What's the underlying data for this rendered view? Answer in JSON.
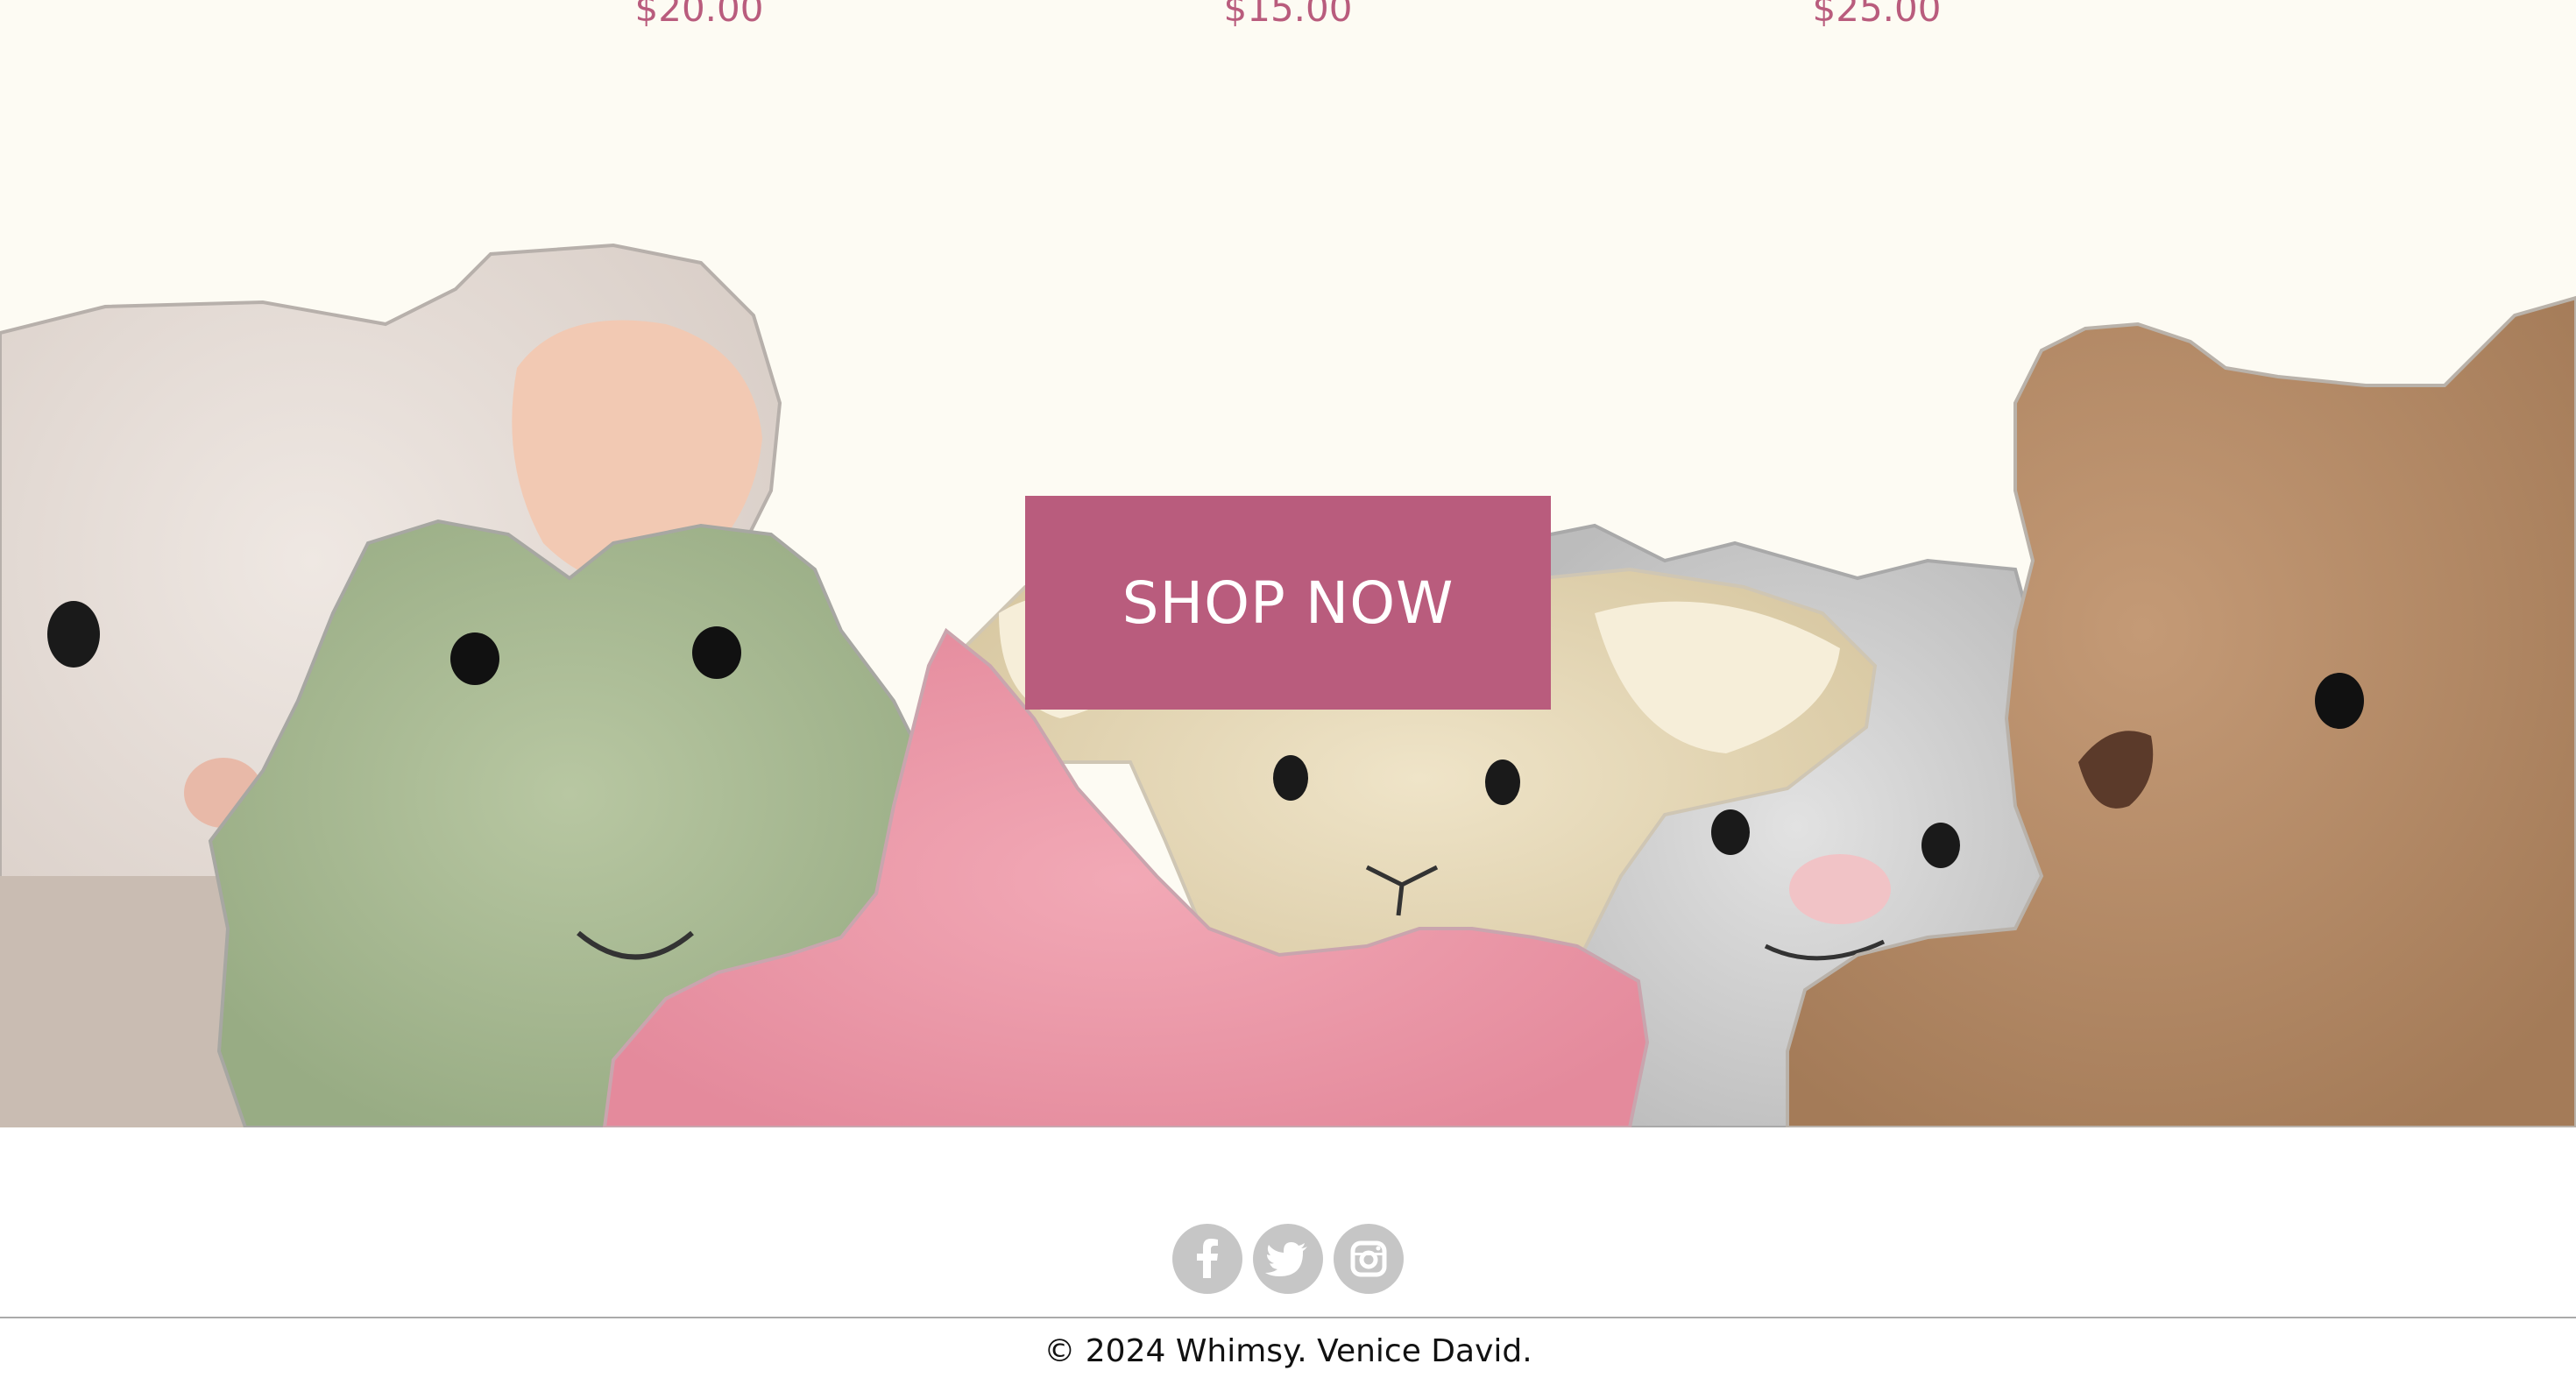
{
  "products": {
    "prices": [
      "$20.00",
      "$15.00",
      "$25.00"
    ]
  },
  "hero": {
    "cta_label": "SHOP NOW",
    "illustration": [
      "mouse plush",
      "frog plush",
      "pink starfish plush",
      "lamb plush",
      "grey bunny plush",
      "brown teddy bear plush"
    ]
  },
  "footer": {
    "social": [
      {
        "name": "facebook",
        "icon": "facebook-icon"
      },
      {
        "name": "twitter",
        "icon": "twitter-icon"
      },
      {
        "name": "instagram",
        "icon": "instagram-icon"
      }
    ],
    "copyright": "© 2024 Whimsy. Venice David."
  },
  "colors": {
    "accent": "#b95c7d",
    "hero_background": "#fdfbf3",
    "social_icon_bg": "#c6c6c6"
  }
}
